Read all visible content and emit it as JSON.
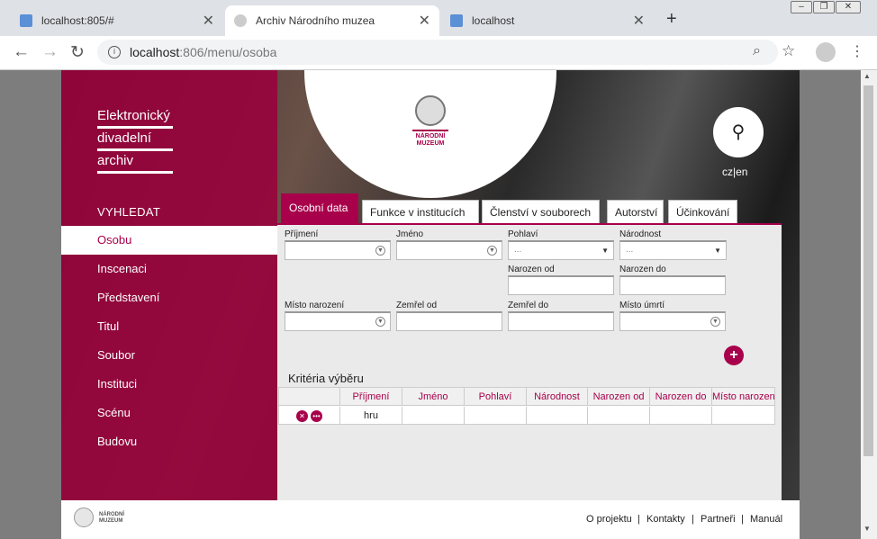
{
  "browser": {
    "tabs": [
      {
        "title": "localhost:805/#"
      },
      {
        "title": "Archiv Národního muzea"
      },
      {
        "title": "localhost"
      }
    ],
    "new_tab": "+",
    "url_host": "localhost",
    "url_path": ":806/menu/osoba",
    "window_controls": [
      "–",
      "❐",
      "✕"
    ]
  },
  "site": {
    "title_lines": [
      "Elektronický",
      "divadelní",
      "archiv"
    ],
    "search_heading": "VYHLEDAT",
    "menu": [
      "Osobu",
      "Inscenaci",
      "Představení",
      "Titul",
      "Soubor",
      "Instituci",
      "Scénu",
      "Budovu"
    ],
    "selected_menu": "Osobu",
    "logo_text": [
      "NÁRODNÍ",
      "MUZEUM"
    ],
    "lang_cz": "cz",
    "lang_sep": "|",
    "lang_en": "en",
    "accent_color": "#a8004a"
  },
  "tabs": [
    "Osobní data",
    "Funkce v institucích",
    "Členství v souborech",
    "Autorství",
    "Účinkování"
  ],
  "form": {
    "prijmeni": "Příjmení",
    "jmeno": "Jméno",
    "pohlavi": "Pohlaví",
    "pohlavi_placeholder": "...",
    "narodnost": "Národnost",
    "narodnost_placeholder": "...",
    "narozen_od": "Narozen od",
    "narozen_do": "Narozen do",
    "misto_narozeni": "Místo narození",
    "zemrel_od": "Zemřel od",
    "zemrel_do": "Zemřel do",
    "misto_umrti": "Místo úmrtí",
    "add_symbol": "+"
  },
  "criteria": {
    "title": "Kritéria výběru",
    "columns": [
      "Příjmení",
      "Jméno",
      "Pohlaví",
      "Národnost",
      "Narozen od",
      "Narozen do",
      "Místo narozen"
    ],
    "rows": [
      {
        "prijmeni": "hru",
        "jmeno": "",
        "pohlavi": "",
        "narodnost": "",
        "narozen_od": "",
        "narozen_do": "",
        "misto": ""
      }
    ]
  },
  "footer": {
    "logo_text": [
      "NÁRODNÍ",
      "MUZEUM"
    ],
    "links": [
      "O projektu",
      "Kontakty",
      "Partneři",
      "Manuál"
    ],
    "separator": "|"
  }
}
